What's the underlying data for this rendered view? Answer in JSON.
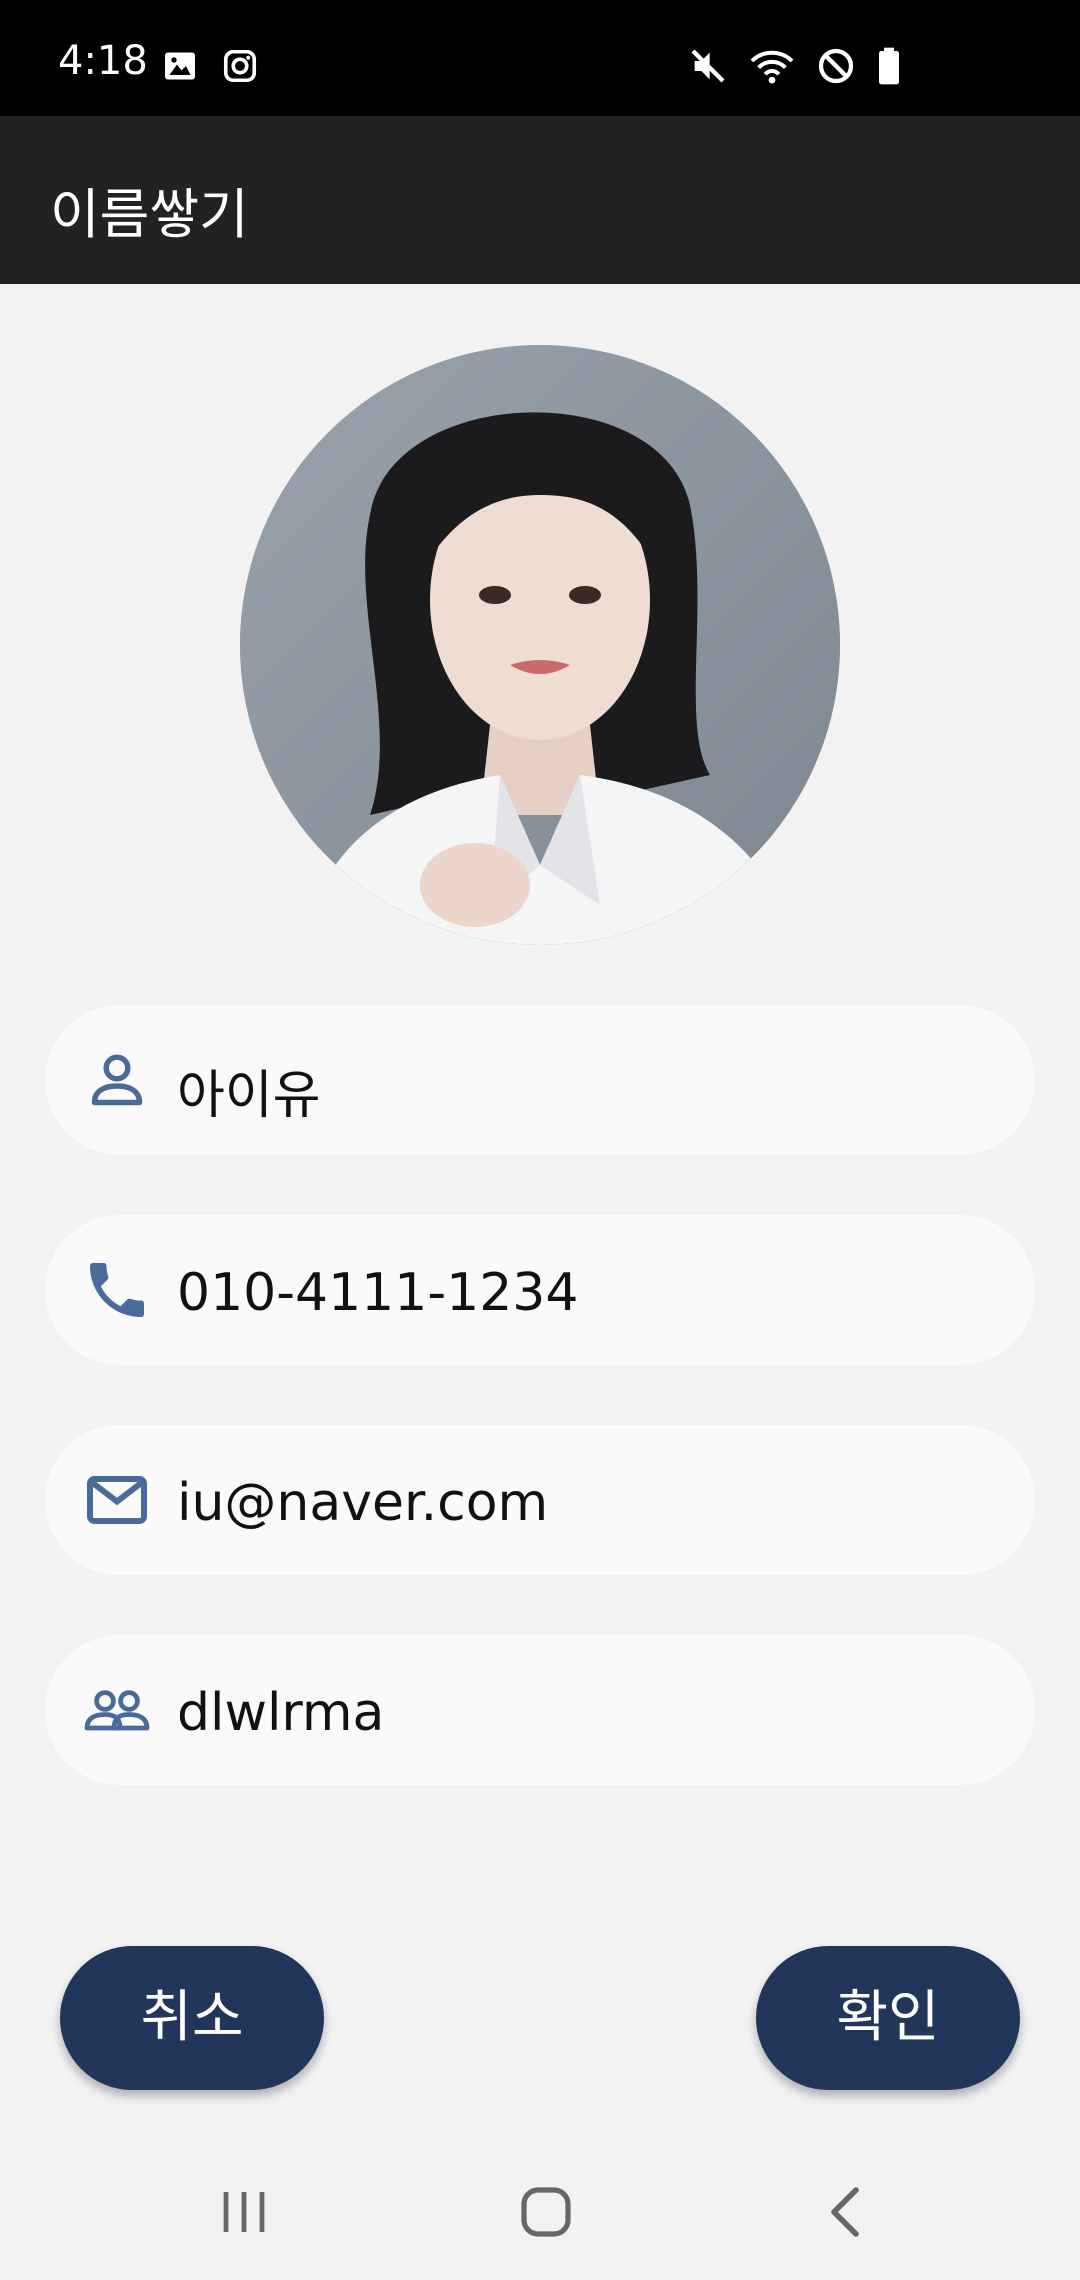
{
  "status_bar": {
    "time": "4:18",
    "left_icons": [
      "image-icon",
      "instagram-icon"
    ],
    "right_icons": [
      "mute-icon",
      "wifi-icon",
      "do-not-disturb-icon",
      "battery-icon"
    ]
  },
  "app_bar": {
    "title": "이름쌓기"
  },
  "profile": {
    "avatar_icon": "profile-photo"
  },
  "fields": {
    "name": {
      "icon": "person-icon",
      "value": "아이유"
    },
    "phone": {
      "icon": "phone-icon",
      "value": "010-4111-1234"
    },
    "email": {
      "icon": "mail-icon",
      "value": "iu@naver.com"
    },
    "group": {
      "icon": "group-icon",
      "value": "dlwlrma"
    }
  },
  "buttons": {
    "cancel_label": "취소",
    "confirm_label": "확인"
  },
  "colors": {
    "accent": "#22355a",
    "icon": "#4a6a99",
    "app_bar": "#222222",
    "background": "#f2f2f2"
  },
  "nav_bar": {
    "items": [
      "recents-icon",
      "home-icon",
      "back-icon"
    ]
  }
}
